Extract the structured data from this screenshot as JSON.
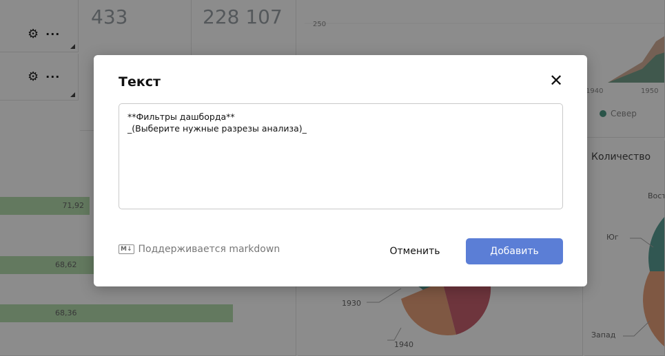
{
  "dashboard": {
    "kpi_values": [
      "433",
      "228 107"
    ],
    "area_chart": {
      "y_tick": "250",
      "x_ticks": [
        "1940",
        "1950"
      ],
      "legend": [
        {
          "name": "Север",
          "color": "#4e9a86"
        }
      ]
    },
    "bar_values": [
      "71,92",
      "68,62",
      "68,36"
    ],
    "pie_years": [
      "1930",
      "1940"
    ],
    "region_pie": {
      "title": "Количество",
      "labels": [
        "Вост",
        "Юг",
        "Запад"
      ]
    },
    "colors": {
      "bar": "#b4dcae",
      "area_brown": "#c28f6e",
      "area_teal": "#4e9a86",
      "pie_teal": "#5a9e95",
      "pie_orange": "#e8a07a",
      "pie_red": "#c9626f"
    }
  },
  "dialog": {
    "title": "Текст",
    "close_icon": "close-icon",
    "text_value": "**Фильтры дашборда**\n_(Выберите нужные разрезы анализа)_",
    "markdown_badge": "M↓",
    "markdown_hint": "Поддерживается markdown",
    "cancel_label": "Отменить",
    "add_label": "Добавить",
    "accent_color": "#5b7ed6"
  }
}
